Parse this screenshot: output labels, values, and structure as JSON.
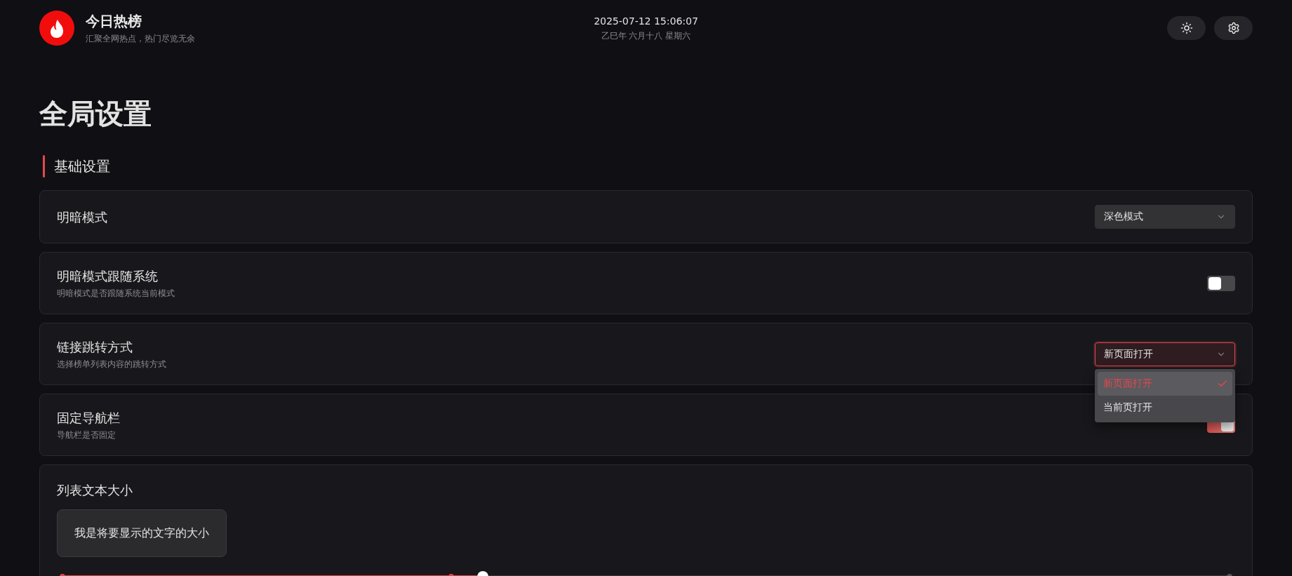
{
  "header": {
    "title": "今日热榜",
    "subtitle": "汇聚全网热点，热门尽览无余",
    "datetime": "2025-07-12 15:06:07",
    "lunar_date": "乙巳年 六月十八 星期六"
  },
  "page": {
    "title": "全局设置"
  },
  "sections": [
    {
      "title": "基础设置",
      "settings": [
        {
          "kind": "select",
          "label": "明暗模式",
          "value": "深色模式",
          "expanded": false
        },
        {
          "kind": "switch",
          "label": "明暗模式跟随系统",
          "description": "明暗模式是否跟随系统当前模式",
          "on": false
        },
        {
          "kind": "select",
          "label": "链接跳转方式",
          "description": "选择榜单列表内容的跳转方式",
          "value": "新页面打开",
          "expanded": true,
          "options": [
            {
              "label": "新页面打开",
              "selected": true
            },
            {
              "label": "当前页打开",
              "selected": false
            }
          ]
        },
        {
          "kind": "switch",
          "label": "固定导航栏",
          "description": "导航栏是否固定",
          "on": true
        },
        {
          "kind": "slider",
          "label": "列表文本大小",
          "preview": "我是将要显示的文字的大小",
          "level": 0.36
        }
      ]
    }
  ]
}
